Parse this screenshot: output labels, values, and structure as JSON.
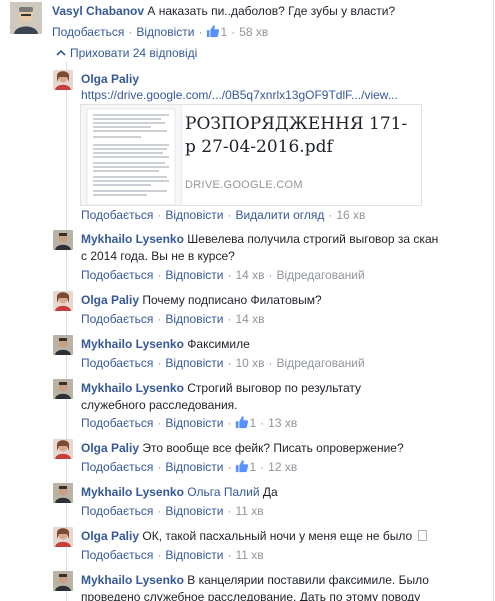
{
  "top_comment": {
    "author": "Vasyl Chabanov",
    "text": "А наказать пи..даболов? Где зубы у власти?",
    "like_label": "Подобається",
    "reply_label": "Відповісти",
    "like_count": "1",
    "time": "58 хв"
  },
  "hide_replies_label": "Приховати 24 відповіді",
  "replies": [
    {
      "author": "Olga Paliy",
      "link_text": "https://drive.google.com/.../0B5q7xnrlx13gOF9TdlF.../view...",
      "preview_title": "РОЗПОРЯДЖЕННЯ 171-р 27-04-2016.pdf",
      "preview_domain": "DRIVE.GOOGLE.COM",
      "like_label": "Подобається",
      "reply_label": "Відповісти",
      "remove_preview_label": "Видалити огляд",
      "time": "16 хв"
    },
    {
      "author": "Mykhailo Lysenko",
      "text": "Шевелева получила строгий выговор за скан с 2014 года. Вы не в курсе?",
      "like_label": "Подобається",
      "reply_label": "Відповісти",
      "time": "14 хв",
      "edited": "Відредагований"
    },
    {
      "author": "Olga Paliy",
      "text": "Почему подписано Филатовым?",
      "like_label": "Подобається",
      "reply_label": "Відповісти",
      "time": "14 хв"
    },
    {
      "author": "Mykhailo Lysenko",
      "text": "Факсимиле",
      "like_label": "Подобається",
      "reply_label": "Відповісти",
      "time": "10 хв",
      "edited": "Відредагований"
    },
    {
      "author": "Mykhailo Lysenko",
      "text": "Строгий выговор по результату служебного расследования.",
      "like_label": "Подобається",
      "reply_label": "Відповісти",
      "like_count": "1",
      "time": "13 хв"
    },
    {
      "author": "Olga Paliy",
      "text": "Это вообще все фейк? Писать опровержение?",
      "like_label": "Подобається",
      "reply_label": "Відповісти",
      "like_count": "1",
      "time": "12 хв"
    },
    {
      "author": "Mykhailo Lysenko",
      "mention": "Ольга Палий",
      "text": "Да",
      "like_label": "Подобається",
      "reply_label": "Відповісти",
      "time": "11 хв"
    },
    {
      "author": "Olga Paliy",
      "text": "ОК, такой пасхальный ночи у меня еще не было",
      "like_label": "Подобається",
      "reply_label": "Відповісти",
      "time": "11 хв"
    },
    {
      "author": "Mykhailo Lysenko",
      "text": "В канцелярии поставили факсимиле. Было проведено служебное расследование. Дать по этому поводу"
    }
  ],
  "colors": {
    "link": "#365899",
    "meta": "#90949c",
    "text": "#1d2129"
  },
  "icons": {
    "like": "thumbs-up-icon",
    "collapse": "chevron-up-icon"
  }
}
